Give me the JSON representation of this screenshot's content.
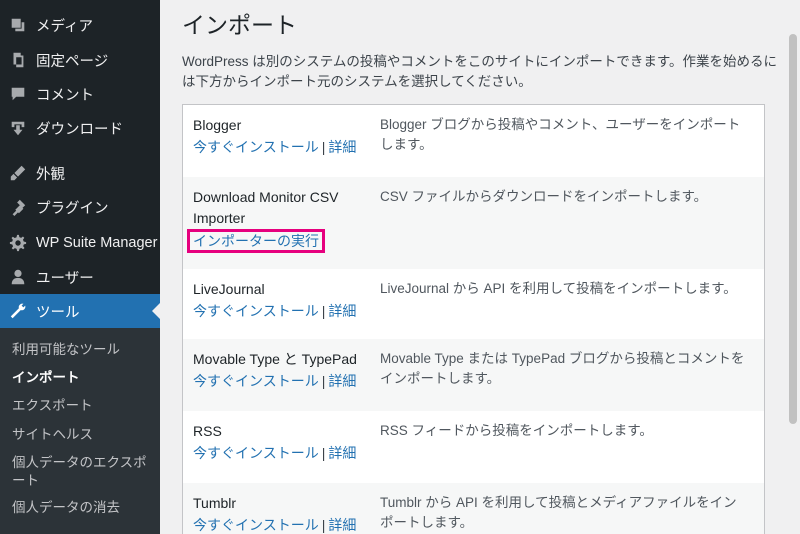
{
  "sidebar": {
    "items": [
      {
        "label": "メディア",
        "icon": "media-icon"
      },
      {
        "label": "固定ページ",
        "icon": "pages-icon"
      },
      {
        "label": "コメント",
        "icon": "comments-icon"
      },
      {
        "label": "ダウンロード",
        "icon": "download-icon"
      },
      {
        "label": "外観",
        "icon": "appearance-icon"
      },
      {
        "label": "プラグイン",
        "icon": "plugins-icon"
      },
      {
        "label": "WP Suite Manager",
        "icon": "gear-icon"
      },
      {
        "label": "ユーザー",
        "icon": "users-icon"
      },
      {
        "label": "ツール",
        "icon": "wrench-icon"
      }
    ],
    "submenu": [
      {
        "label": "利用可能なツール"
      },
      {
        "label": "インポート"
      },
      {
        "label": "エクスポート"
      },
      {
        "label": "サイトヘルス"
      },
      {
        "label": "個人データのエクスポート"
      },
      {
        "label": "個人データの消去"
      }
    ]
  },
  "main": {
    "title": "インポート",
    "intro": "WordPress は別のシステムの投稿やコメントをこのサイトにインポートできます。作業を始めるには下方からインポート元のシステムを選択してください。",
    "importers": [
      {
        "name": "Blogger",
        "install": "今すぐインストール",
        "sep": "|",
        "details": "詳細",
        "desc": "Blogger ブログから投稿やコメント、ユーザーをインポートします。"
      },
      {
        "name": "Download Monitor CSV Importer",
        "run": "インポーターの実行",
        "desc": "CSV ファイルからダウンロードをインポートします。"
      },
      {
        "name": "LiveJournal",
        "install": "今すぐインストール",
        "sep": "|",
        "details": "詳細",
        "desc": "LiveJournal から API を利用して投稿をインポートします。"
      },
      {
        "name": "Movable Type と TypePad",
        "install": "今すぐインストール",
        "sep": "|",
        "details": "詳細",
        "desc": "Movable Type または TypePad ブログから投稿とコメントをインポートします。"
      },
      {
        "name": "RSS",
        "install": "今すぐインストール",
        "sep": "|",
        "details": "詳細",
        "desc": "RSS フィードから投稿をインポートします。"
      },
      {
        "name": "Tumblr",
        "install": "今すぐインストール",
        "sep": "|",
        "details": "詳細",
        "desc": "Tumblr から API を利用して投稿とメディアファイルをインポートします。"
      }
    ]
  }
}
